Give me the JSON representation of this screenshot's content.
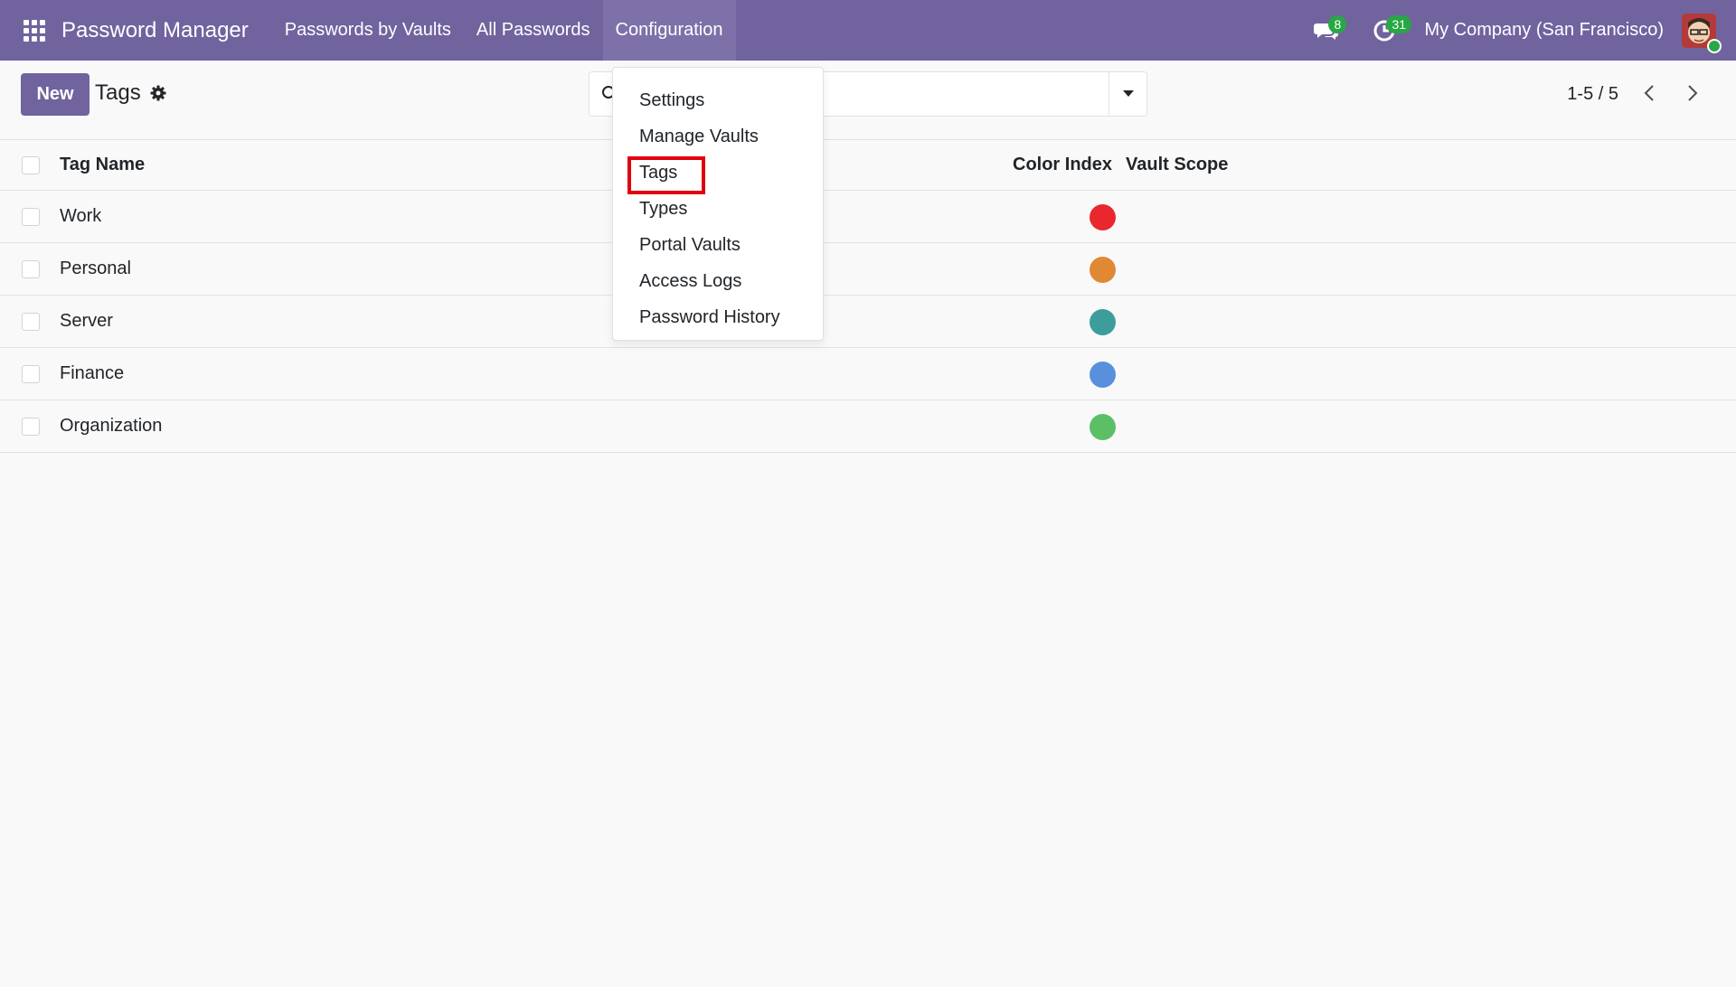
{
  "navbar": {
    "brand": "Password Manager",
    "menu": [
      "Passwords by Vaults",
      "All Passwords",
      "Configuration"
    ],
    "messages_count": "8",
    "activities_count": "31",
    "company": "My Company (San Francisco)",
    "bg_color": "#71639e"
  },
  "control_panel": {
    "new_label": "New",
    "breadcrumb": "Tags",
    "search_placeholder": "",
    "pager": "1-5 / 5"
  },
  "dropdown": {
    "items": [
      "Settings",
      "Manage Vaults",
      "Tags",
      "Types",
      "Portal Vaults",
      "Access Logs",
      "Password History"
    ],
    "highlighted": "Tags"
  },
  "list": {
    "columns": [
      "Tag Name",
      "Color Index",
      "Vault Scope"
    ],
    "rows": [
      {
        "name": "Work",
        "color": "#e8282e"
      },
      {
        "name": "Personal",
        "color": "#e08834"
      },
      {
        "name": "Server",
        "color": "#3d9d9b"
      },
      {
        "name": "Finance",
        "color": "#5890de"
      },
      {
        "name": "Organization",
        "color": "#5cbf66"
      }
    ]
  }
}
